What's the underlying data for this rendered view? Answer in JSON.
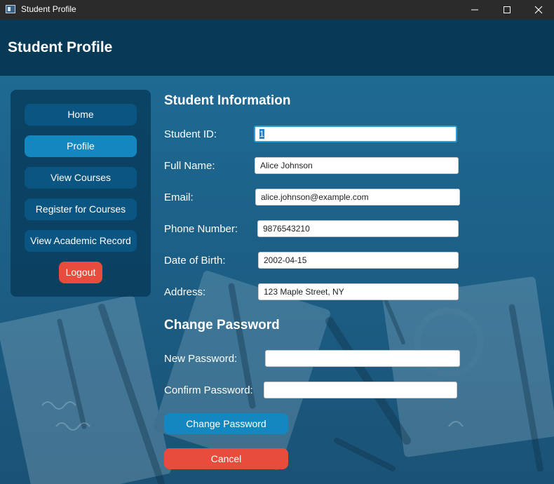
{
  "window": {
    "title": "Student Profile"
  },
  "header": {
    "title": "Student Profile"
  },
  "sidebar": {
    "items": [
      {
        "label": "Home"
      },
      {
        "label": "Profile",
        "active": true
      },
      {
        "label": "View Courses"
      },
      {
        "label": "Register for Courses"
      },
      {
        "label": "View Academic Record"
      }
    ],
    "logout_label": "Logout"
  },
  "student_info": {
    "title": "Student Information",
    "student_id": {
      "label": "Student ID:",
      "value": "1"
    },
    "full_name": {
      "label": "Full Name:",
      "value": "Alice Johnson"
    },
    "email": {
      "label": "Email:",
      "value": "alice.johnson@example.com"
    },
    "phone": {
      "label": "Phone Number:",
      "value": "9876543210"
    },
    "dob": {
      "label": "Date of Birth:",
      "value": "2002-04-15"
    },
    "address": {
      "label": "Address:",
      "value": "123 Maple Street, NY"
    }
  },
  "change_password": {
    "title": "Change Password",
    "new_password": {
      "label": "New Password:",
      "value": ""
    },
    "confirm_password": {
      "label": "Confirm Password:",
      "value": ""
    },
    "submit_label": "Change Password",
    "cancel_label": "Cancel"
  },
  "colors": {
    "header_bg": "#063a57",
    "primary_button": "#1387bf",
    "danger_button": "#e74c3c",
    "nav_button": "#0b5582"
  }
}
